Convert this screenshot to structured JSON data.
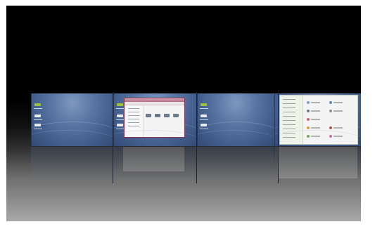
{
  "view": {
    "name": "workspace-switcher-3d-wall",
    "workspace_count": 4,
    "active_workspace": 2
  },
  "workspaces": [
    {
      "id": "ws-1",
      "windows": []
    },
    {
      "id": "ws-2",
      "windows": [
        "file-manager"
      ]
    },
    {
      "id": "ws-3",
      "windows": []
    },
    {
      "id": "ws-4",
      "windows": [
        "control-panel"
      ]
    }
  ],
  "colors": {
    "desktop": "#4f6c9b",
    "frame": "#26375a",
    "background_top": "#000000",
    "background_bottom": "#a8a8a8",
    "file_manager_title": "#b66c87"
  },
  "icons": [
    "computer-icon",
    "folder-icon",
    "trash-icon",
    "drive-icon"
  ]
}
